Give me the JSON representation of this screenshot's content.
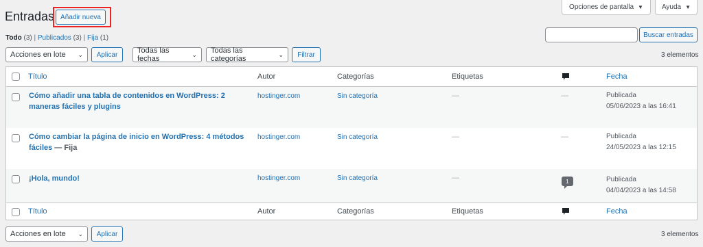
{
  "header": {
    "title": "Entradas",
    "add_new": "Añadir nueva",
    "screen_options": "Opciones de pantalla",
    "help": "Ayuda"
  },
  "filters_links": {
    "all_label": "Todo",
    "all_count": "(3)",
    "sep": "|",
    "published_label": "Publicados",
    "published_count": "(3)",
    "sticky_label": "Fija",
    "sticky_count": "(1)"
  },
  "search": {
    "value": "",
    "button": "Buscar entradas"
  },
  "toolbar_top": {
    "bulk_actions": "Acciones en lote",
    "apply": "Aplicar",
    "dates": "Todas las fechas",
    "categories": "Todas las categorías",
    "filter": "Filtrar",
    "items": "3 elementos"
  },
  "toolbar_bottom": {
    "bulk_actions": "Acciones en lote",
    "apply": "Aplicar",
    "items": "3 elementos"
  },
  "columns": {
    "title": "Título",
    "author": "Autor",
    "categories": "Categorías",
    "tags": "Etiquetas",
    "comments_icon": "comment-icon",
    "date": "Fecha"
  },
  "posts": [
    {
      "title": "Cómo añadir una tabla de contenidos en WordPress: 2 maneras fáciles y plugins",
      "state": "",
      "author": "hostinger.com",
      "category": "Sin categoría",
      "tags": "—",
      "comments": "—",
      "status": "Publicada",
      "date": "05/06/2023 a las 16:41"
    },
    {
      "title": "Cómo cambiar la página de inicio en WordPress: 4 métodos fáciles",
      "state": " — Fija",
      "author": "hostinger.com",
      "category": "Sin categoría",
      "tags": "—",
      "comments": "—",
      "status": "Publicada",
      "date": "24/05/2023 a las 12:15"
    },
    {
      "title": "¡Hola, mundo!",
      "state": "",
      "author": "hostinger.com",
      "category": "Sin categoría",
      "tags": "—",
      "comments": "1",
      "status": "Publicada",
      "date": "04/04/2023 a las 14:58"
    }
  ],
  "colors": {
    "accent": "#2271b1",
    "highlight": "#ee2222",
    "background": "#f0f0f1"
  }
}
